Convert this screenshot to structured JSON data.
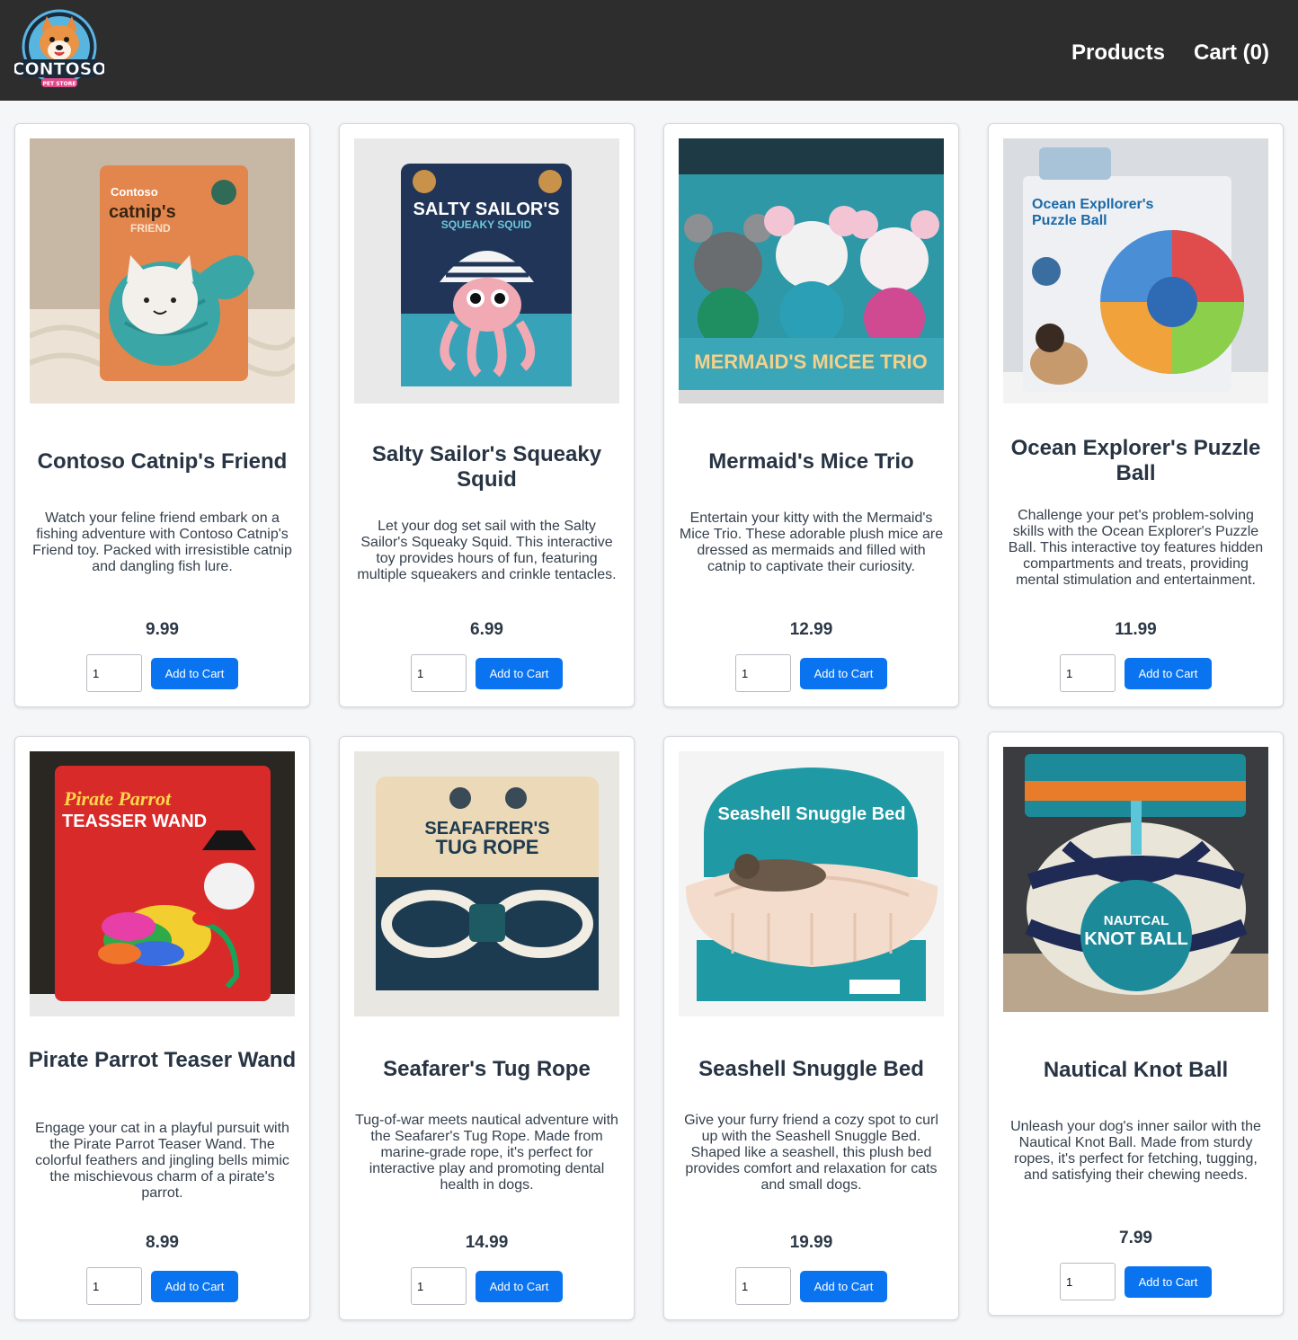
{
  "header": {
    "logo_text": "CONTOSO",
    "logo_subtext": "PET STORE",
    "nav": {
      "products": "Products",
      "cart": "Cart (0)"
    }
  },
  "products": [
    {
      "title": "Contoso Catnip's Friend",
      "description": "Watch your feline friend embark on a fishing adventure with Contoso Catnip's Friend toy. Packed with irresistible catnip and dangling fish lure.",
      "price": "9.99",
      "qty": "1",
      "button": "Add to Cart",
      "image_text": [
        "Contoso",
        "catnip's",
        "FRIEND"
      ],
      "image_colors": [
        "#c7b8a6",
        "#e3864e",
        "#3aa7a6"
      ]
    },
    {
      "title": "Salty Sailor's Squeaky Squid",
      "description": "Let your dog set sail with the Salty Sailor's Squeaky Squid. This interactive toy provides hours of fun, featuring multiple squeakers and crinkle tentacles.",
      "price": "6.99",
      "qty": "1",
      "button": "Add to Cart",
      "image_text": [
        "SALTY SAILOR'S",
        "SQUEAKY SQUID"
      ],
      "image_colors": [
        "#e9e9ea",
        "#203558",
        "#f1a9b4"
      ]
    },
    {
      "title": "Mermaid's Mice Trio",
      "description": "Entertain your kitty with the Mermaid's Mice Trio. These adorable plush mice are dressed as mermaids and filled with catnip to captivate their curiosity.",
      "price": "12.99",
      "qty": "1",
      "button": "Add to Cart",
      "image_text": [
        "MERMAID'S MICEE TRIO"
      ],
      "image_colors": [
        "#2e98a6",
        "#f1f1f1",
        "#1f8e60"
      ]
    },
    {
      "title": "Ocean Explorer's Puzzle Ball",
      "description": "Challenge your pet's problem-solving skills with the Ocean Explorer's Puzzle Ball. This interactive toy features hidden compartments and treats, providing mental stimulation and entertainment.",
      "price": "11.99",
      "qty": "1",
      "button": "Add to Cart",
      "image_text": [
        "Ocean Expllorer's",
        "Puzzle Ball"
      ],
      "image_colors": [
        "#eef0f3",
        "#1b6aa8",
        "#e04b4b"
      ]
    },
    {
      "title": "Pirate Parrot Teaser Wand",
      "description": "Engage your cat in a playful pursuit with the Pirate Parrot Teaser Wand. The colorful feathers and jingling bells mimic the mischievous charm of a pirate's parrot.",
      "price": "8.99",
      "qty": "1",
      "button": "Add to Cart",
      "image_text": [
        "Pirate Parrot",
        "TEASSER WAND"
      ],
      "image_colors": [
        "#2a2622",
        "#d92a2a",
        "#18a35a"
      ]
    },
    {
      "title": "Seafarer's Tug Rope",
      "description": "Tug-of-war meets nautical adventure with the Seafarer's Tug Rope. Made from marine-grade rope, it's perfect for interactive play and promoting dental health in dogs.",
      "price": "14.99",
      "qty": "1",
      "button": "Add to Cart",
      "image_text": [
        "SEAFAFRER'S",
        "TUG ROPE"
      ],
      "image_colors": [
        "#e9e7e2",
        "#1c3a50",
        "#f2ede2"
      ]
    },
    {
      "title": "Seashell Snuggle Bed",
      "description": "Give your furry friend a cozy spot to curl up with the Seashell Snuggle Bed. Shaped like a seashell, this plush bed provides comfort and relaxation for cats and small dogs.",
      "price": "19.99",
      "qty": "1",
      "button": "Add to Cart",
      "image_text": [
        "Seashell Snuggle Bed"
      ],
      "image_colors": [
        "#f4f4f4",
        "#1f9aa4",
        "#f3dccb"
      ]
    },
    {
      "title": "Nautical Knot Ball",
      "description": "Unleash your dog's inner sailor with the Nautical Knot Ball. Made from sturdy ropes, it's perfect for fetching, tugging, and satisfying their chewing needs.",
      "price": "7.99",
      "qty": "1",
      "button": "Add to Cart",
      "image_text": [
        "NAUTCAL",
        "KNOT BALL"
      ],
      "image_colors": [
        "#3a3c40",
        "#1d8a9a",
        "#1f2a55"
      ]
    }
  ]
}
